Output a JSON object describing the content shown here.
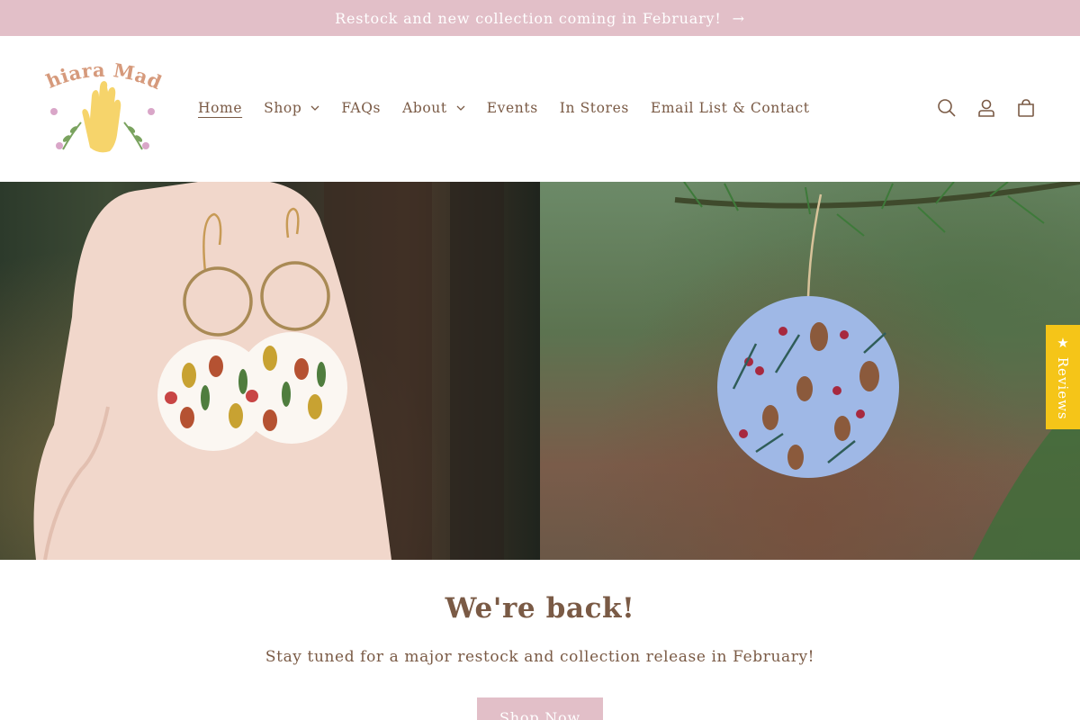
{
  "announcement": {
    "text": "Restock and new collection coming in February!",
    "arrow": "→"
  },
  "brand": {
    "logo_text": "Chiara Made"
  },
  "nav": {
    "items": [
      {
        "label": "Home",
        "active": true,
        "has_dropdown": false
      },
      {
        "label": "Shop",
        "active": false,
        "has_dropdown": true
      },
      {
        "label": "FAQs",
        "active": false,
        "has_dropdown": false
      },
      {
        "label": "About",
        "active": false,
        "has_dropdown": true
      },
      {
        "label": "Events",
        "active": false,
        "has_dropdown": false
      },
      {
        "label": "In Stores",
        "active": false,
        "has_dropdown": false
      },
      {
        "label": "Email List & Contact",
        "active": false,
        "has_dropdown": false
      }
    ]
  },
  "header_icons": [
    "search-icon",
    "account-icon",
    "cart-icon"
  ],
  "hero": {
    "left_image": "hand-holding-earrings-photo",
    "right_image": "ornament-on-pine-branch-photo"
  },
  "reviews_tab": {
    "label": "★ Reviews"
  },
  "main": {
    "headline": "We're back!",
    "subline": "Stay tuned for a major restock and collection release in February!",
    "cta_label": "Shop Now"
  },
  "colors": {
    "accent_pink": "#e2bfc8",
    "text_brown": "#7a5a45",
    "logo_yellow": "#f6d46b",
    "reviews_yellow": "#f5c518"
  }
}
